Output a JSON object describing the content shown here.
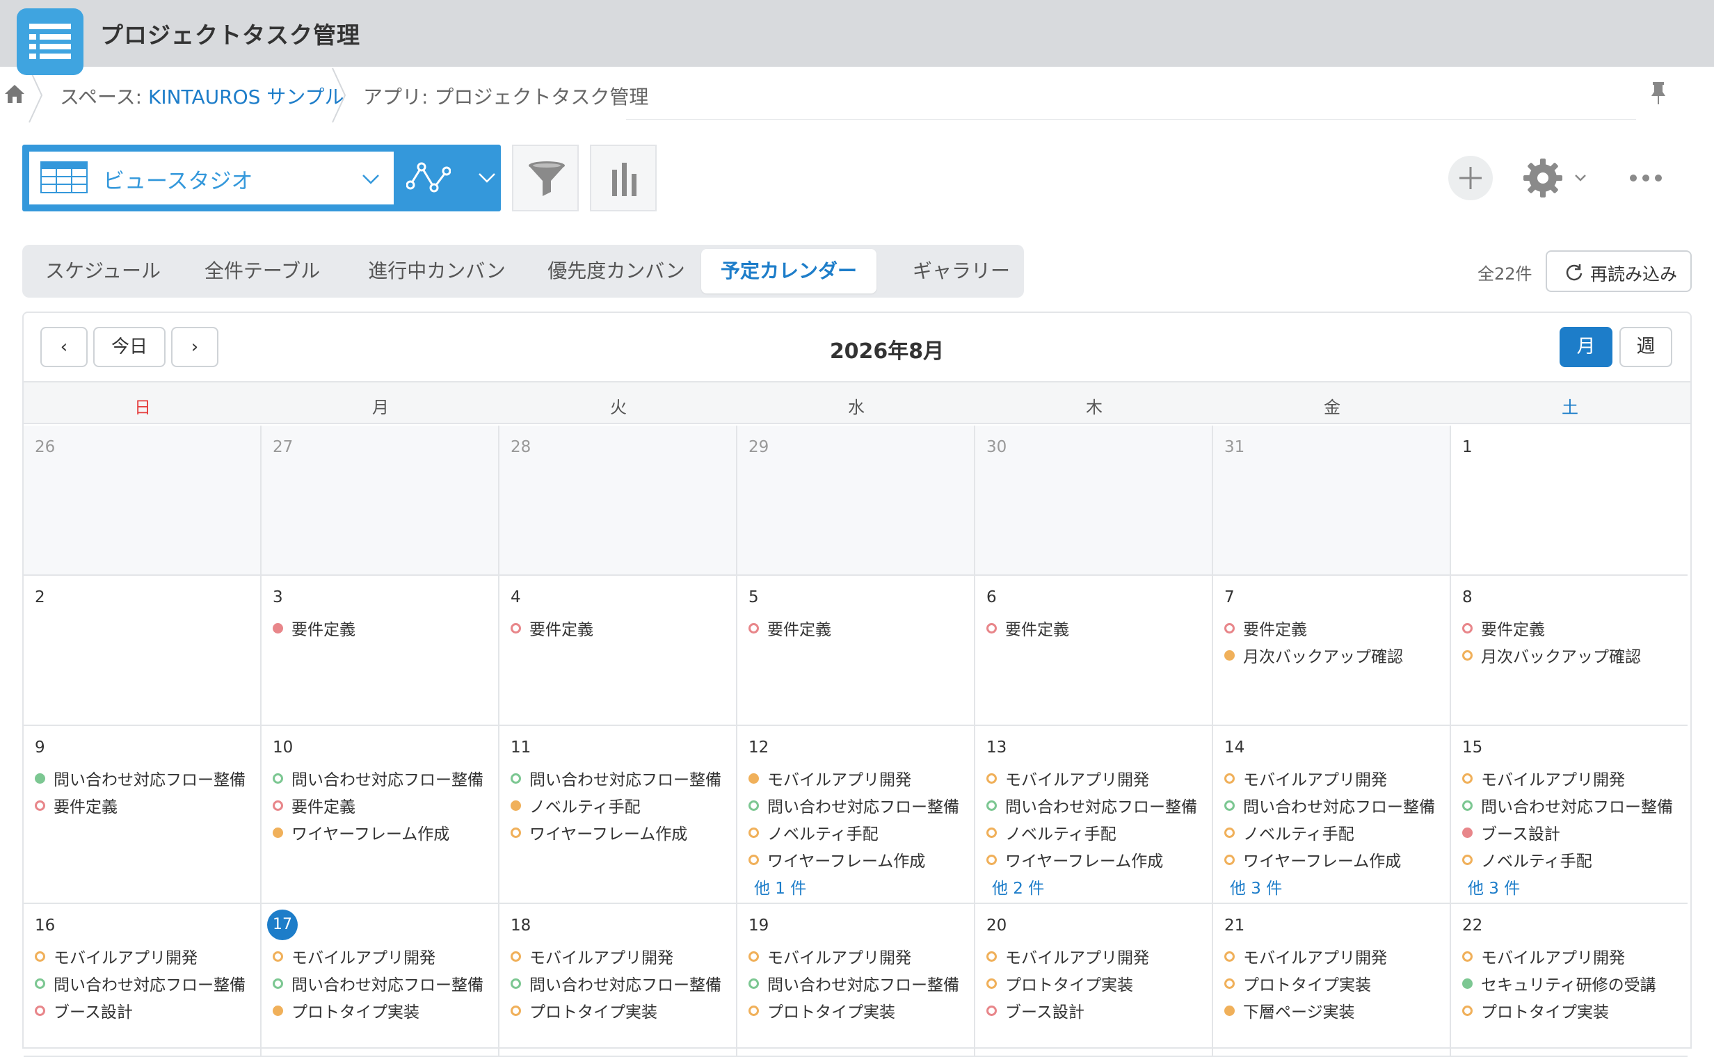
{
  "header": {
    "app_title": "プロジェクトタスク管理"
  },
  "breadcrumb": {
    "space_prefix": "スペース: ",
    "space_name": "KINTAUROS サンプル",
    "app_label": "アプリ: プロジェクトタスク管理"
  },
  "toolbar": {
    "view_name": "ビュースタジオ"
  },
  "tabs": [
    {
      "label": "スケジュール"
    },
    {
      "label": "全件テーブル"
    },
    {
      "label": "進行中カンバン"
    },
    {
      "label": "優先度カンバン"
    },
    {
      "label": "予定カレンダー",
      "active": true
    },
    {
      "label": "ギャラリー"
    }
  ],
  "record_count": "全22件",
  "reload_label": "再読み込み",
  "calendar": {
    "title": "2026年8月",
    "prev_label": "‹",
    "today_label": "今日",
    "next_label": "›",
    "month_label": "月",
    "week_label": "週",
    "weekdays": [
      "日",
      "月",
      "火",
      "水",
      "木",
      "金",
      "土"
    ],
    "colors": {
      "red": "#e8868a",
      "orange": "#f0b05a",
      "green": "#7cc792",
      "accent": "#1d7dc9",
      "sunday": "#e53e3e"
    },
    "weeks": [
      [
        {
          "day": "26",
          "outside": true,
          "events": []
        },
        {
          "day": "27",
          "outside": true,
          "events": []
        },
        {
          "day": "28",
          "outside": true,
          "events": []
        },
        {
          "day": "29",
          "outside": true,
          "events": []
        },
        {
          "day": "30",
          "outside": true,
          "events": []
        },
        {
          "day": "31",
          "outside": true,
          "events": []
        },
        {
          "day": "1",
          "events": []
        }
      ],
      [
        {
          "day": "2",
          "events": []
        },
        {
          "day": "3",
          "events": [
            {
              "title": "要件定義",
              "color": "red",
              "filled": true
            }
          ]
        },
        {
          "day": "4",
          "events": [
            {
              "title": "要件定義",
              "color": "red",
              "filled": false
            }
          ]
        },
        {
          "day": "5",
          "events": [
            {
              "title": "要件定義",
              "color": "red",
              "filled": false
            }
          ]
        },
        {
          "day": "6",
          "events": [
            {
              "title": "要件定義",
              "color": "red",
              "filled": false
            }
          ]
        },
        {
          "day": "7",
          "events": [
            {
              "title": "要件定義",
              "color": "red",
              "filled": false
            },
            {
              "title": "月次バックアップ確認",
              "color": "orange",
              "filled": true
            }
          ]
        },
        {
          "day": "8",
          "events": [
            {
              "title": "要件定義",
              "color": "red",
              "filled": false
            },
            {
              "title": "月次バックアップ確認",
              "color": "orange",
              "filled": false
            }
          ]
        }
      ],
      [
        {
          "day": "9",
          "events": [
            {
              "title": "問い合わせ対応フロー整備",
              "color": "green",
              "filled": true
            },
            {
              "title": "要件定義",
              "color": "red",
              "filled": false
            }
          ]
        },
        {
          "day": "10",
          "events": [
            {
              "title": "問い合わせ対応フロー整備",
              "color": "green",
              "filled": false
            },
            {
              "title": "要件定義",
              "color": "red",
              "filled": false
            },
            {
              "title": "ワイヤーフレーム作成",
              "color": "orange",
              "filled": true
            }
          ]
        },
        {
          "day": "11",
          "events": [
            {
              "title": "問い合わせ対応フロー整備",
              "color": "green",
              "filled": false
            },
            {
              "title": "ノベルティ手配",
              "color": "orange",
              "filled": true
            },
            {
              "title": "ワイヤーフレーム作成",
              "color": "orange",
              "filled": false
            }
          ]
        },
        {
          "day": "12",
          "events": [
            {
              "title": "モバイルアプリ開発",
              "color": "orange",
              "filled": true
            },
            {
              "title": "問い合わせ対応フロー整備",
              "color": "green",
              "filled": false
            },
            {
              "title": "ノベルティ手配",
              "color": "orange",
              "filled": false
            },
            {
              "title": "ワイヤーフレーム作成",
              "color": "orange",
              "filled": false
            }
          ],
          "more": "他 1 件"
        },
        {
          "day": "13",
          "events": [
            {
              "title": "モバイルアプリ開発",
              "color": "orange",
              "filled": false
            },
            {
              "title": "問い合わせ対応フロー整備",
              "color": "green",
              "filled": false
            },
            {
              "title": "ノベルティ手配",
              "color": "orange",
              "filled": false
            },
            {
              "title": "ワイヤーフレーム作成",
              "color": "orange",
              "filled": false
            }
          ],
          "more": "他 2 件"
        },
        {
          "day": "14",
          "events": [
            {
              "title": "モバイルアプリ開発",
              "color": "orange",
              "filled": false
            },
            {
              "title": "問い合わせ対応フロー整備",
              "color": "green",
              "filled": false
            },
            {
              "title": "ノベルティ手配",
              "color": "orange",
              "filled": false
            },
            {
              "title": "ワイヤーフレーム作成",
              "color": "orange",
              "filled": false
            }
          ],
          "more": "他 3 件"
        },
        {
          "day": "15",
          "events": [
            {
              "title": "モバイルアプリ開発",
              "color": "orange",
              "filled": false
            },
            {
              "title": "問い合わせ対応フロー整備",
              "color": "green",
              "filled": false
            },
            {
              "title": "ブース設計",
              "color": "red",
              "filled": true
            },
            {
              "title": "ノベルティ手配",
              "color": "orange",
              "filled": false
            }
          ],
          "more": "他 3 件"
        }
      ],
      [
        {
          "day": "16",
          "events": [
            {
              "title": "モバイルアプリ開発",
              "color": "orange",
              "filled": false
            },
            {
              "title": "問い合わせ対応フロー整備",
              "color": "green",
              "filled": false
            },
            {
              "title": "ブース設計",
              "color": "red",
              "filled": false
            }
          ]
        },
        {
          "day": "17",
          "today": true,
          "events": [
            {
              "title": "モバイルアプリ開発",
              "color": "orange",
              "filled": false
            },
            {
              "title": "問い合わせ対応フロー整備",
              "color": "green",
              "filled": false
            },
            {
              "title": "プロトタイプ実装",
              "color": "orange",
              "filled": true
            }
          ]
        },
        {
          "day": "18",
          "events": [
            {
              "title": "モバイルアプリ開発",
              "color": "orange",
              "filled": false
            },
            {
              "title": "問い合わせ対応フロー整備",
              "color": "green",
              "filled": false
            },
            {
              "title": "プロトタイプ実装",
              "color": "orange",
              "filled": false
            }
          ]
        },
        {
          "day": "19",
          "events": [
            {
              "title": "モバイルアプリ開発",
              "color": "orange",
              "filled": false
            },
            {
              "title": "問い合わせ対応フロー整備",
              "color": "green",
              "filled": false
            },
            {
              "title": "プロトタイプ実装",
              "color": "orange",
              "filled": false
            }
          ]
        },
        {
          "day": "20",
          "events": [
            {
              "title": "モバイルアプリ開発",
              "color": "orange",
              "filled": false
            },
            {
              "title": "プロトタイプ実装",
              "color": "orange",
              "filled": false
            },
            {
              "title": "ブース設計",
              "color": "red",
              "filled": false
            }
          ]
        },
        {
          "day": "21",
          "events": [
            {
              "title": "モバイルアプリ開発",
              "color": "orange",
              "filled": false
            },
            {
              "title": "プロトタイプ実装",
              "color": "orange",
              "filled": false
            },
            {
              "title": "下層ページ実装",
              "color": "orange",
              "filled": true
            }
          ]
        },
        {
          "day": "22",
          "events": [
            {
              "title": "モバイルアプリ開発",
              "color": "orange",
              "filled": false
            },
            {
              "title": "セキュリティ研修の受講",
              "color": "green",
              "filled": true
            },
            {
              "title": "プロトタイプ実装",
              "color": "orange",
              "filled": false
            }
          ]
        }
      ]
    ]
  }
}
